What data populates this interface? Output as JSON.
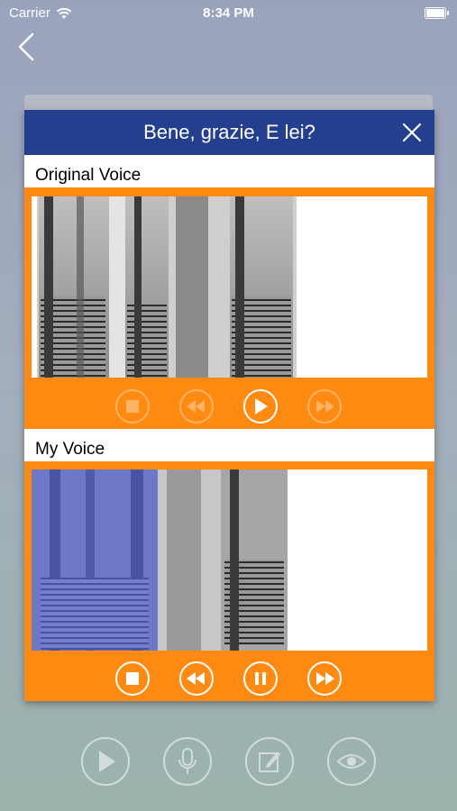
{
  "status_bar": {
    "carrier": "Carrier",
    "time": "8:34 PM"
  },
  "nav": {
    "back_icon": "chevron-left-icon"
  },
  "dialog": {
    "title": "Bene, grazie, E lei?",
    "close_icon": "close-icon",
    "header_color": "#233f8e",
    "accent_color": "#ff8a12"
  },
  "original_voice": {
    "label": "Original Voice",
    "controls": [
      {
        "name": "stop",
        "icon": "stop-icon",
        "enabled": false
      },
      {
        "name": "rewind",
        "icon": "rewind-icon",
        "enabled": false
      },
      {
        "name": "play",
        "icon": "play-icon",
        "enabled": true
      },
      {
        "name": "fast-forward",
        "icon": "fast-forward-icon",
        "enabled": false
      }
    ]
  },
  "my_voice": {
    "label": "My Voice",
    "playback_progress": 0.32,
    "highlight_color": "#5a6cf0",
    "controls": [
      {
        "name": "stop",
        "icon": "stop-icon",
        "enabled": true
      },
      {
        "name": "rewind",
        "icon": "rewind-icon",
        "enabled": true
      },
      {
        "name": "pause",
        "icon": "pause-icon",
        "enabled": true
      },
      {
        "name": "fast-forward",
        "icon": "fast-forward-icon",
        "enabled": true
      }
    ]
  },
  "bottom_toolbar": [
    {
      "name": "play",
      "icon": "play-icon"
    },
    {
      "name": "record",
      "icon": "microphone-icon"
    },
    {
      "name": "edit",
      "icon": "edit-icon"
    },
    {
      "name": "show",
      "icon": "eye-icon"
    }
  ]
}
